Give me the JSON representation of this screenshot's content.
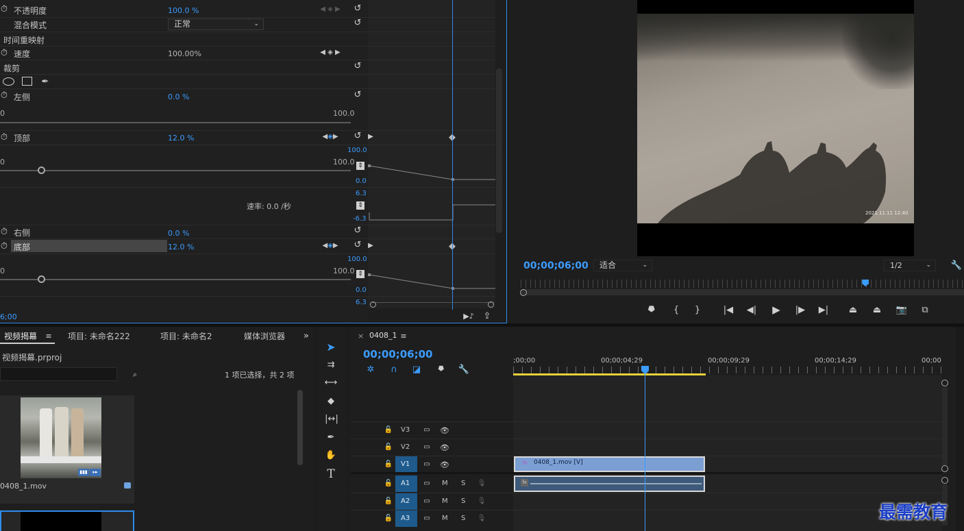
{
  "effect_controls": {
    "opacity_label": "不透明度",
    "opacity_value": "100.0 %",
    "blend_label": "混合模式",
    "blend_value": "正常",
    "time_remap_label": "时间重映射",
    "speed_label": "速度",
    "speed_value": "100.00%",
    "crop_label": "裁剪",
    "left_label": "左侧",
    "left_value": "0.0 %",
    "slider_min": "0",
    "slider_max": "100.0",
    "top_label": "顶部",
    "top_value": "12.0 %",
    "graph_max": "100.0",
    "graph_min": "0.0",
    "velocity_max": "6.3",
    "velocity_min": "-6.3",
    "velocity_label": "速率: 0.0 /秒",
    "right_label": "右侧",
    "right_value": "0.0 %",
    "bottom_label": "底部",
    "bottom_value": "12.0 %",
    "graph2_max": "100.0",
    "graph2_min": "0.0",
    "graph2_vmax": "6.3",
    "bottom_timecode": "6;00",
    "top_slider_level": 0.12,
    "bottom_slider_level": 0.12
  },
  "program_monitor": {
    "timecode": "00;00;06;00",
    "fit_value": "适合",
    "resolution_value": "1/2",
    "photo_stamp": "2021.11.11 12:40",
    "playhead_fraction": 0.77
  },
  "project_panel": {
    "tabs": [
      "视频揭幕",
      "项目: 未命名222",
      "项目: 未命名2",
      "媒体浏览器"
    ],
    "project_file": "视频揭幕.prproj",
    "selection_info": "1 项已选择，共 2 项",
    "clip_name": "0408_1.mov"
  },
  "timeline": {
    "sequence_name": "0408_1",
    "timecode": "00;00;06;00",
    "ruler_labels": [
      ";00;00",
      "00;00;04;29",
      "00;00;09;29",
      "00;00;14;29",
      "00;00"
    ],
    "video_tracks": [
      "V3",
      "V2",
      "V1"
    ],
    "audio_tracks": [
      "A1",
      "A2",
      "A3"
    ],
    "track_m": "M",
    "track_s": "S",
    "video_clip_label": "0408_1.mov [V]"
  },
  "watermark": "最需教育",
  "colors": {
    "accent": "#2d8ceb",
    "clip_video": "#7b9fd3",
    "clip_audio": "#3e5a7a",
    "work_area": "#e6d23a",
    "fx_badge": "#b05ac0",
    "watermark": "#1c3fc4"
  },
  "icons": [
    "stopwatch-icon",
    "reset-icon",
    "keyframe-nav-icon",
    "ellipse-mask-icon",
    "rect-mask-icon",
    "pen-mask-icon",
    "selection-tool-icon",
    "track-select-icon",
    "ripple-edit-icon",
    "razor-icon",
    "slip-icon",
    "pen-tool-icon",
    "hand-tool-icon",
    "type-tool-icon",
    "lock-icon",
    "eye-icon",
    "mic-icon",
    "camera-icon",
    "wrench-icon",
    "play-icon",
    "marker-icon"
  ]
}
